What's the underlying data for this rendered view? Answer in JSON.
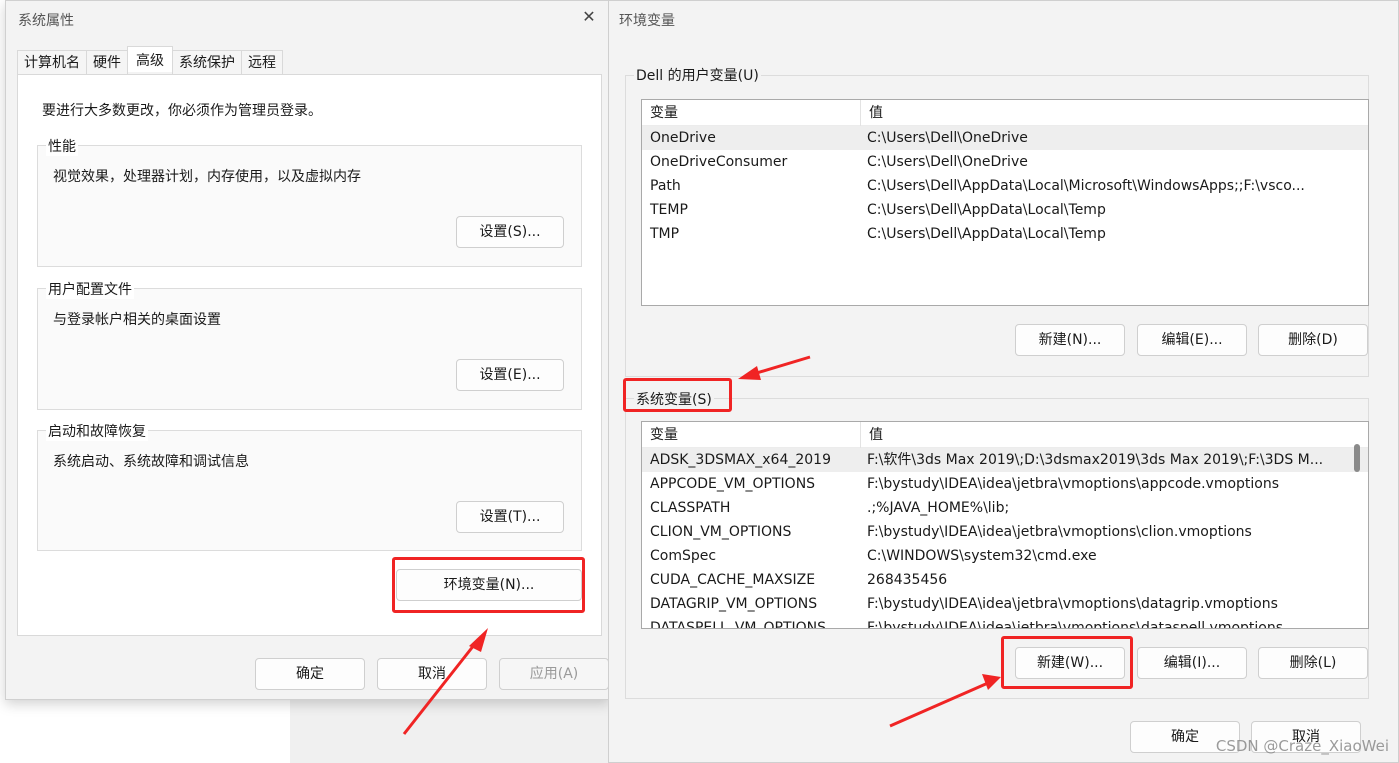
{
  "system_properties": {
    "title": "系统属性",
    "tabs": [
      "计算机名",
      "硬件",
      "高级",
      "系统保护",
      "远程"
    ],
    "admin_note": "要进行大多数更改，你必须作为管理员登录。",
    "performance": {
      "title": "性能",
      "desc": "视觉效果，处理器计划，内存使用，以及虚拟内存",
      "button": "设置(S)..."
    },
    "user_profiles": {
      "title": "用户配置文件",
      "desc": "与登录帐户相关的桌面设置",
      "button": "设置(E)..."
    },
    "startup_recovery": {
      "title": "启动和故障恢复",
      "desc": "系统启动、系统故障和调试信息",
      "button": "设置(T)..."
    },
    "env_button": "环境变量(N)...",
    "ok": "确定",
    "cancel": "取消",
    "apply": "应用(A)"
  },
  "environment_variables": {
    "title": "环境变量",
    "user_group_title": "Dell 的用户变量(U)",
    "col_variable": "变量",
    "col_value": "值",
    "user_vars": [
      {
        "name": "OneDrive",
        "value": "C:\\Users\\Dell\\OneDrive"
      },
      {
        "name": "OneDriveConsumer",
        "value": "C:\\Users\\Dell\\OneDrive"
      },
      {
        "name": "Path",
        "value": "C:\\Users\\Dell\\AppData\\Local\\Microsoft\\WindowsApps;;F:\\vsco..."
      },
      {
        "name": "TEMP",
        "value": "C:\\Users\\Dell\\AppData\\Local\\Temp"
      },
      {
        "name": "TMP",
        "value": "C:\\Users\\Dell\\AppData\\Local\\Temp"
      }
    ],
    "user_buttons": {
      "new": "新建(N)...",
      "edit": "编辑(E)...",
      "delete": "删除(D)"
    },
    "system_group_title": "系统变量(S)",
    "system_vars": [
      {
        "name": "ADSK_3DSMAX_x64_2019",
        "value": "F:\\软件\\3ds Max 2019\\;D:\\3dsmax2019\\3ds Max 2019\\;F:\\3DS M..."
      },
      {
        "name": "APPCODE_VM_OPTIONS",
        "value": "F:\\bystudy\\IDEA\\idea\\jetbra\\vmoptions\\appcode.vmoptions"
      },
      {
        "name": "CLASSPATH",
        "value": ".;%JAVA_HOME%\\lib;"
      },
      {
        "name": "CLION_VM_OPTIONS",
        "value": "F:\\bystudy\\IDEA\\idea\\jetbra\\vmoptions\\clion.vmoptions"
      },
      {
        "name": "ComSpec",
        "value": "C:\\WINDOWS\\system32\\cmd.exe"
      },
      {
        "name": "CUDA_CACHE_MAXSIZE",
        "value": "268435456"
      },
      {
        "name": "DATAGRIP_VM_OPTIONS",
        "value": "F:\\bystudy\\IDEA\\idea\\jetbra\\vmoptions\\datagrip.vmoptions"
      },
      {
        "name": "DATASPELL_VM_OPTIONS",
        "value": "F:\\bystudy\\IDEA\\idea\\jetbra\\vmoptions\\dataspell.vmoptions"
      }
    ],
    "system_buttons": {
      "new": "新建(W)...",
      "edit": "编辑(I)...",
      "delete": "删除(L)"
    },
    "ok": "确定",
    "cancel": "取消"
  },
  "watermark": "CSDN @Craze_XiaoWei",
  "colors": {
    "highlight_red": "#f02424"
  }
}
